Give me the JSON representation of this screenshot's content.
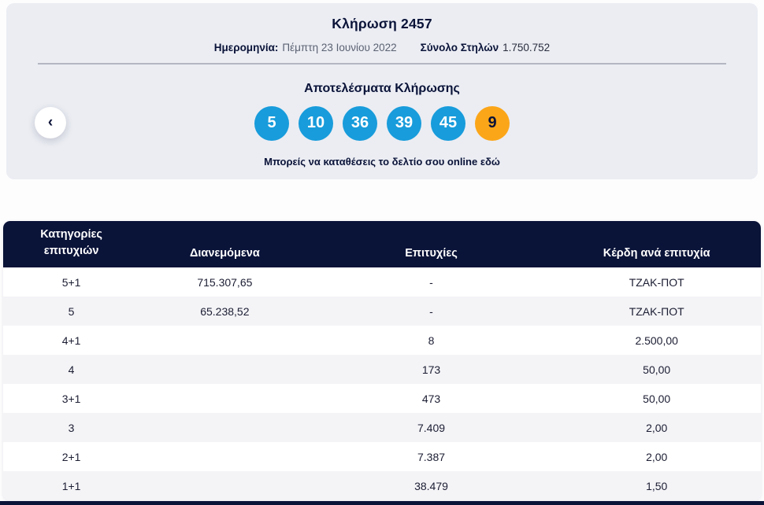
{
  "draw": {
    "title": "Κλήρωση 2457",
    "date_label": "Ημερομηνία:",
    "date_value": "Πέμπτη 23 Ιουνίου 2022",
    "columns_label": "Σύνολο Στηλών",
    "columns_value": "1.750.752"
  },
  "results": {
    "title": "Αποτελέσματα Κλήρωσης",
    "numbers": [
      "5",
      "10",
      "36",
      "39",
      "45"
    ],
    "bonus": "9",
    "cta_text": "Μπορείς να καταθέσεις το δελτίο σου online",
    "cta_link": "εδώ",
    "prev_icon": "‹"
  },
  "table": {
    "headers": [
      "Κατηγορίες επιτυχιών",
      "Διανεμόμενα",
      "Επιτυχίες",
      "Κέρδη ανά επιτυχία"
    ],
    "rows": [
      {
        "category": "5+1",
        "distributed": "715.307,65",
        "winners": "-",
        "prize": "ΤΖΑΚ-ΠΟΤ"
      },
      {
        "category": "5",
        "distributed": "65.238,52",
        "winners": "-",
        "prize": "ΤΖΑΚ-ΠΟΤ"
      },
      {
        "category": "4+1",
        "distributed": "",
        "winners": "8",
        "prize": "2.500,00"
      },
      {
        "category": "4",
        "distributed": "",
        "winners": "173",
        "prize": "50,00"
      },
      {
        "category": "3+1",
        "distributed": "",
        "winners": "473",
        "prize": "50,00"
      },
      {
        "category": "3",
        "distributed": "",
        "winners": "7.409",
        "prize": "2,00"
      },
      {
        "category": "2+1",
        "distributed": "",
        "winners": "7.387",
        "prize": "2,00"
      },
      {
        "category": "1+1",
        "distributed": "",
        "winners": "38.479",
        "prize": "1,50"
      }
    ]
  },
  "colors": {
    "navy": "#0a1338",
    "card_bg": "#ebedf3",
    "ball_blue": "#189cdb",
    "ball_orange": "#fba619",
    "row_alt": "#f4f4f7",
    "muted_text": "#5c6272"
  }
}
